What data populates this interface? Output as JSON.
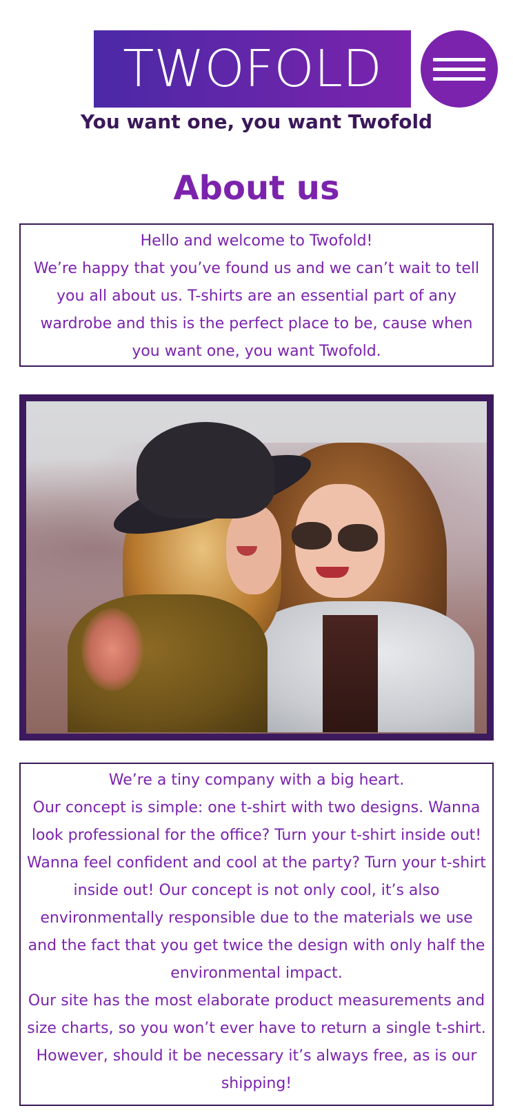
{
  "header": {
    "logo_text": "TWOFOLD",
    "tagline": "You want one, you want Twofold",
    "menu_icon": "hamburger-icon"
  },
  "page": {
    "title": "About us"
  },
  "intro": {
    "lines": [
      "Hello and welcome to Twofold!",
      "We’re happy that you’ve found us and we can’t wait to tell you all about us. T-shirts are an essential part of any wardrobe and this is the perfect place to be, cause when you want one, you want Twofold."
    ]
  },
  "photo": {
    "alt": "Two women with sunglasses laughing together outdoors"
  },
  "details": {
    "lines": [
      "We’re a tiny company with a big heart.",
      "Our concept is simple: one t-shirt with two designs. Wanna look professional for the office? Turn your t-shirt inside out! Wanna feel confident and cool at the party? Turn your t-shirt inside out! Our concept is not only cool, it’s also environmentally responsible due to the materials we use and the fact that you get twice the design with only half the environmental impact.",
      "Our site has the most elaborate product measurements and size charts, so you won’t ever have to return a single t-shirt. However, should it be necessary it’s always free, as is our shipping!"
    ]
  },
  "colors": {
    "brand_purple": "#7b23ad",
    "deep_purple": "#3a1858",
    "frame_purple": "#3d1a5e",
    "logo_gradient_start": "#4b29a6"
  }
}
